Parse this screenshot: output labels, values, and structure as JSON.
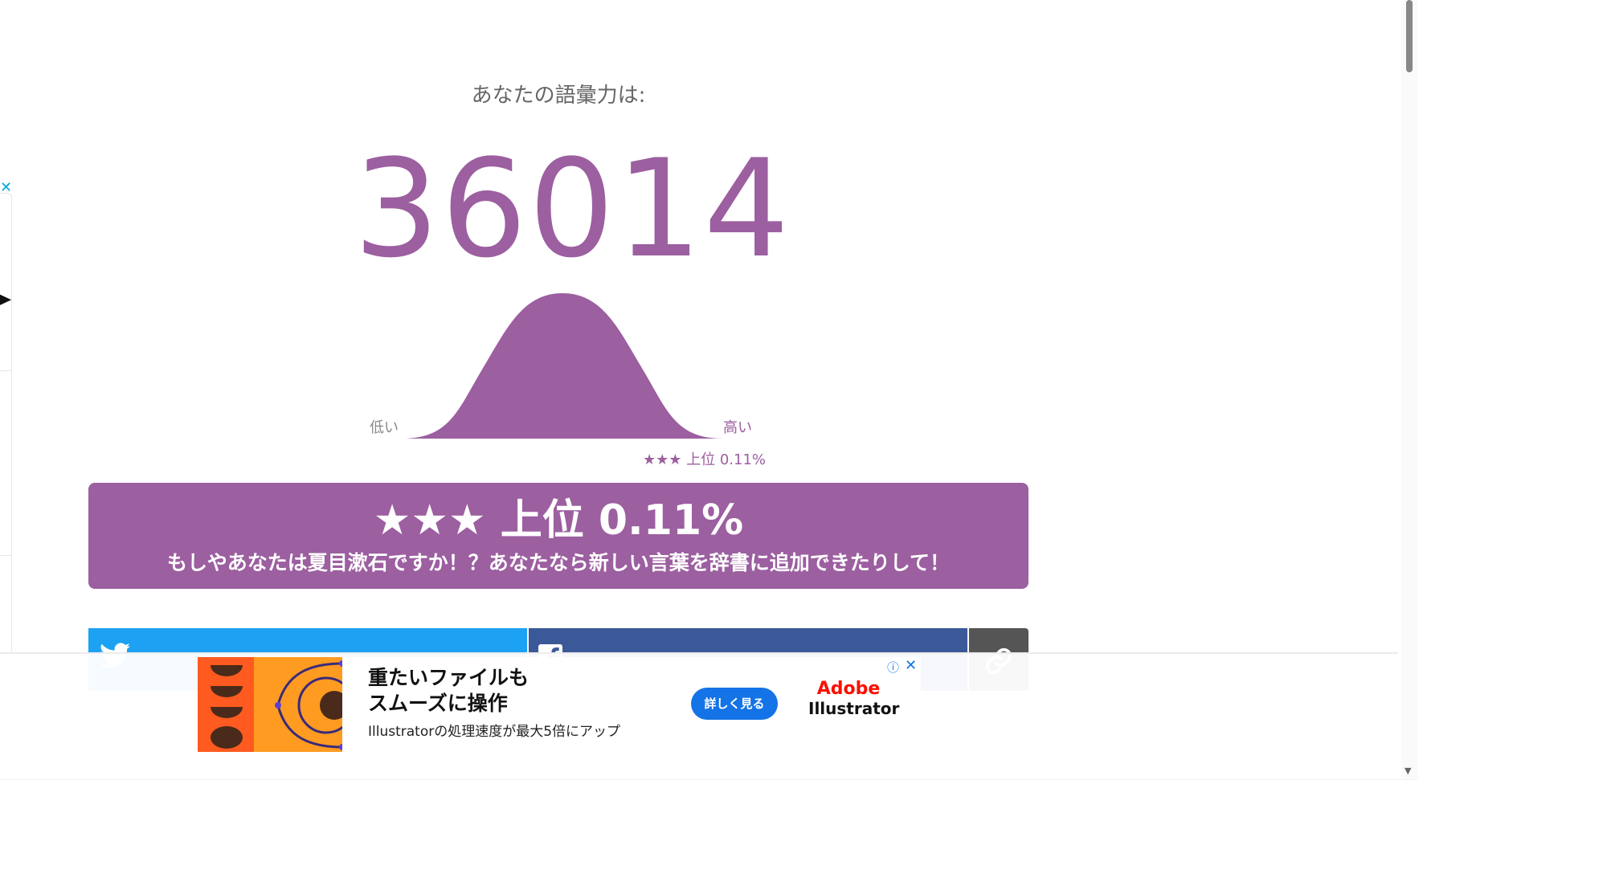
{
  "result": {
    "subtitle": "あなたの語彙力は:",
    "score": "36014",
    "curve_low_label": "低い",
    "curve_high_label": "高い",
    "marker_rank": "★★★ 上位 0.11%",
    "banner_rank": "★★★ 上位 0.11%",
    "banner_message": "もしやあなたは夏目漱石ですか！？あなたなら新しい言葉を辞書に追加できたりして！"
  },
  "share": {
    "twitter_icon": "twitter-bird-icon",
    "facebook_icon": "facebook-f-icon",
    "link_icon": "link-chain-icon"
  },
  "ad": {
    "headline_line1": "重たいファイルも",
    "headline_line2": "スムーズに操作",
    "subtext": "Illustratorの処理速度が最大5倍にアップ",
    "cta": "詳しく見る",
    "brand": "Adobe",
    "product": "Illustrator",
    "info_icon": "ⓘ",
    "close_icon": "✕"
  },
  "side_panel": {
    "close_icon": "✕"
  },
  "colors": {
    "accent": "#9c5fa0",
    "twitter": "#1da1f2",
    "facebook": "#3b5998",
    "link": "#555555",
    "ad_cta": "#1473e6",
    "adobe_red": "#fa0f00"
  }
}
